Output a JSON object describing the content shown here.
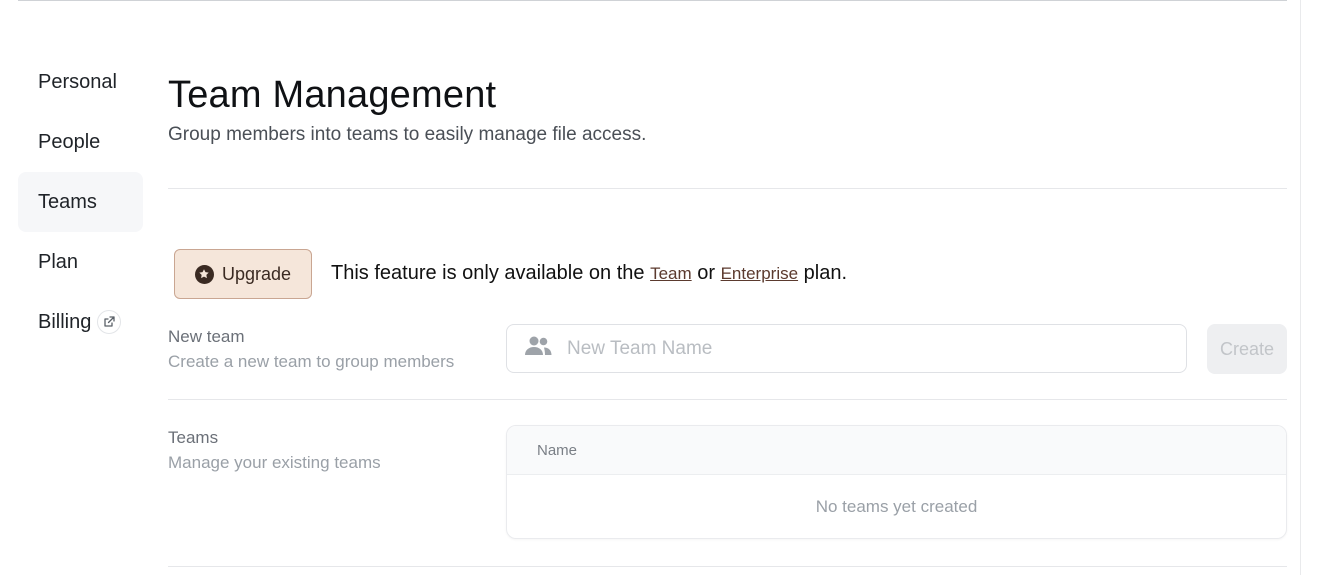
{
  "sidebar": {
    "items": [
      {
        "label": "Personal"
      },
      {
        "label": "People"
      },
      {
        "label": "Teams"
      },
      {
        "label": "Plan"
      },
      {
        "label": "Billing"
      }
    ]
  },
  "header": {
    "title": "Team Management",
    "subtitle": "Group members into teams to easily manage file access."
  },
  "upgrade": {
    "button_label": "Upgrade",
    "text_prefix": "This feature is only available on the",
    "team_link": "Team",
    "or": "or",
    "enterprise_link": "Enterprise",
    "text_suffix": "plan."
  },
  "new_team": {
    "label": "New team",
    "description": "Create a new team to group members",
    "placeholder": "New Team Name",
    "value": "",
    "create_label": "Create"
  },
  "teams": {
    "label": "Teams",
    "description": "Manage your existing teams",
    "columns": [
      "Name"
    ],
    "empty_text": "No teams yet created"
  },
  "colors": {
    "accent_upgrade_bg": "#f5e6da",
    "accent_upgrade_border": "#c9a692",
    "link": "#5b3a2e",
    "active_nav_bg": "#f6f7f9"
  },
  "icons": {
    "upgrade": "star-badge-icon",
    "billing": "external-link-icon",
    "new_team": "people-icon"
  }
}
